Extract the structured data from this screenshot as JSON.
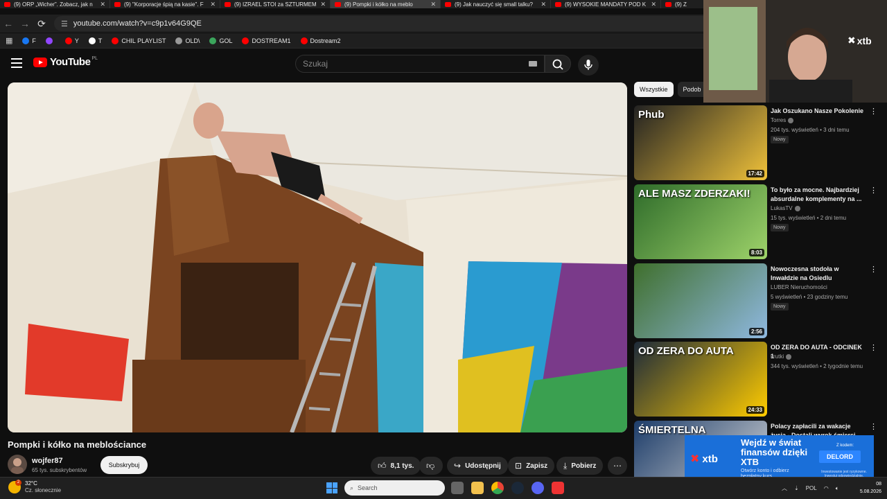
{
  "browser": {
    "tabs": [
      {
        "title": "(9) ORP „Wicher”. Zobacz, jak n",
        "active": false
      },
      {
        "title": "(9) \"Korporacje śpią na kasie\". F",
        "active": false
      },
      {
        "title": "(9) IZRAEL STOI za SZTURMEM",
        "active": false
      },
      {
        "title": "(9) Pompki i kółko na meblo",
        "active": true
      },
      {
        "title": "(9) Jak nauczyć się small talku?",
        "active": false
      },
      {
        "title": "(9) WYSOKIE MANDATY POD K",
        "active": false
      },
      {
        "title": "(9) Z",
        "active": false
      }
    ],
    "url": "youtube.com/watch?v=c9p1v64G9QE",
    "bookmarks": [
      {
        "label": "F",
        "color": "#1877f2"
      },
      {
        "label": "",
        "color": "#9146ff"
      },
      {
        "label": "Y",
        "color": "#ff0000"
      },
      {
        "label": "T",
        "color": "#ffffff"
      },
      {
        "label": "CHIL PLAYLIST",
        "color": "#ff0000"
      },
      {
        "label": "OLD\\",
        "color": "#999999"
      },
      {
        "label": "GOL",
        "color": "#3ba55c"
      },
      {
        "label": "DOSTREAM1",
        "color": "#ff0000"
      },
      {
        "label": "Dostream2",
        "color": "#ff0000"
      }
    ]
  },
  "youtube": {
    "logo_text": "YouTube",
    "country_code": "PL",
    "search_placeholder": "Szukaj"
  },
  "video": {
    "title": "Pompki i kółko na meblościance",
    "channel": "wojfer87",
    "subscribers": "65 tys. subskrybentów",
    "subscribe_label": "Subskrybuj",
    "likes": "8,1 tys.",
    "share_label": "Udostępnij",
    "save_label": "Zapisz",
    "download_label": "Pobierz"
  },
  "sidebar": {
    "chips": [
      "Wszystkie",
      "Podob"
    ],
    "recommendations": [
      {
        "title": "Jak Oszukano Nasze Pokolenie",
        "channel": "Torres",
        "verified": true,
        "meta": "204 tys. wyświetleń • 3 dni temu",
        "badge": "Nowy",
        "duration": "17:42",
        "thumb_text": "Phub"
      },
      {
        "title": "To było za mocne. Najbardziej absurdalne komplementy na ...",
        "channel": "LukasTV",
        "verified": true,
        "meta": "15 tys. wyświetleń • 2 dni temu",
        "badge": "Nowy",
        "duration": "8:03",
        "thumb_text": "ALE MASZ ZDERZAKI!"
      },
      {
        "title": "Nowoczesna stodoła w Inwałdzie na Osiedlu Zagórskim",
        "channel": "LUBER Nieruchomości",
        "verified": false,
        "meta": "5 wyświetleń • 23 godziny temu",
        "badge": "Nowy",
        "duration": "2:56",
        "thumb_text": ""
      },
      {
        "title": "OD ZERA DO AUTA - ODCINEK 1",
        "channel": "krutki",
        "verified": true,
        "meta": "344 tys. wyświetleń • 2 tygodnie temu",
        "badge": "",
        "duration": "24:33",
        "thumb_text": "OD ZERA DO AUTA"
      },
      {
        "title": "Polacy zapłacili za wakacje życia - Dostali wyrok śmierci",
        "channel": "",
        "verified": false,
        "meta": "",
        "badge": "",
        "duration": "",
        "thumb_text": "ŚMIERTELNA"
      }
    ]
  },
  "overlay": {
    "brand": "xtb"
  },
  "ad": {
    "brand": "xtb",
    "headline": "Wejdź w świat finansów dzięki XTB",
    "sub": "Otwórz konto i odbierz bezpłatny kurs",
    "code_label": "Z kodem:",
    "code": "DELORD",
    "legal": "Inwestowanie jest ryzykowne. Inwestuj odpowiedzialnie."
  },
  "taskbar": {
    "weather_temp": "32°C",
    "weather_cond": "Cz. słonecznie",
    "weather_badge": "2",
    "search_placeholder": "Search",
    "lang": "POL",
    "time": "08",
    "date": "5.08.2026"
  },
  "colors": {
    "yt_red": "#ff0000",
    "bg": "#0f0f0f",
    "ad_blue": "#1a6fd9"
  }
}
